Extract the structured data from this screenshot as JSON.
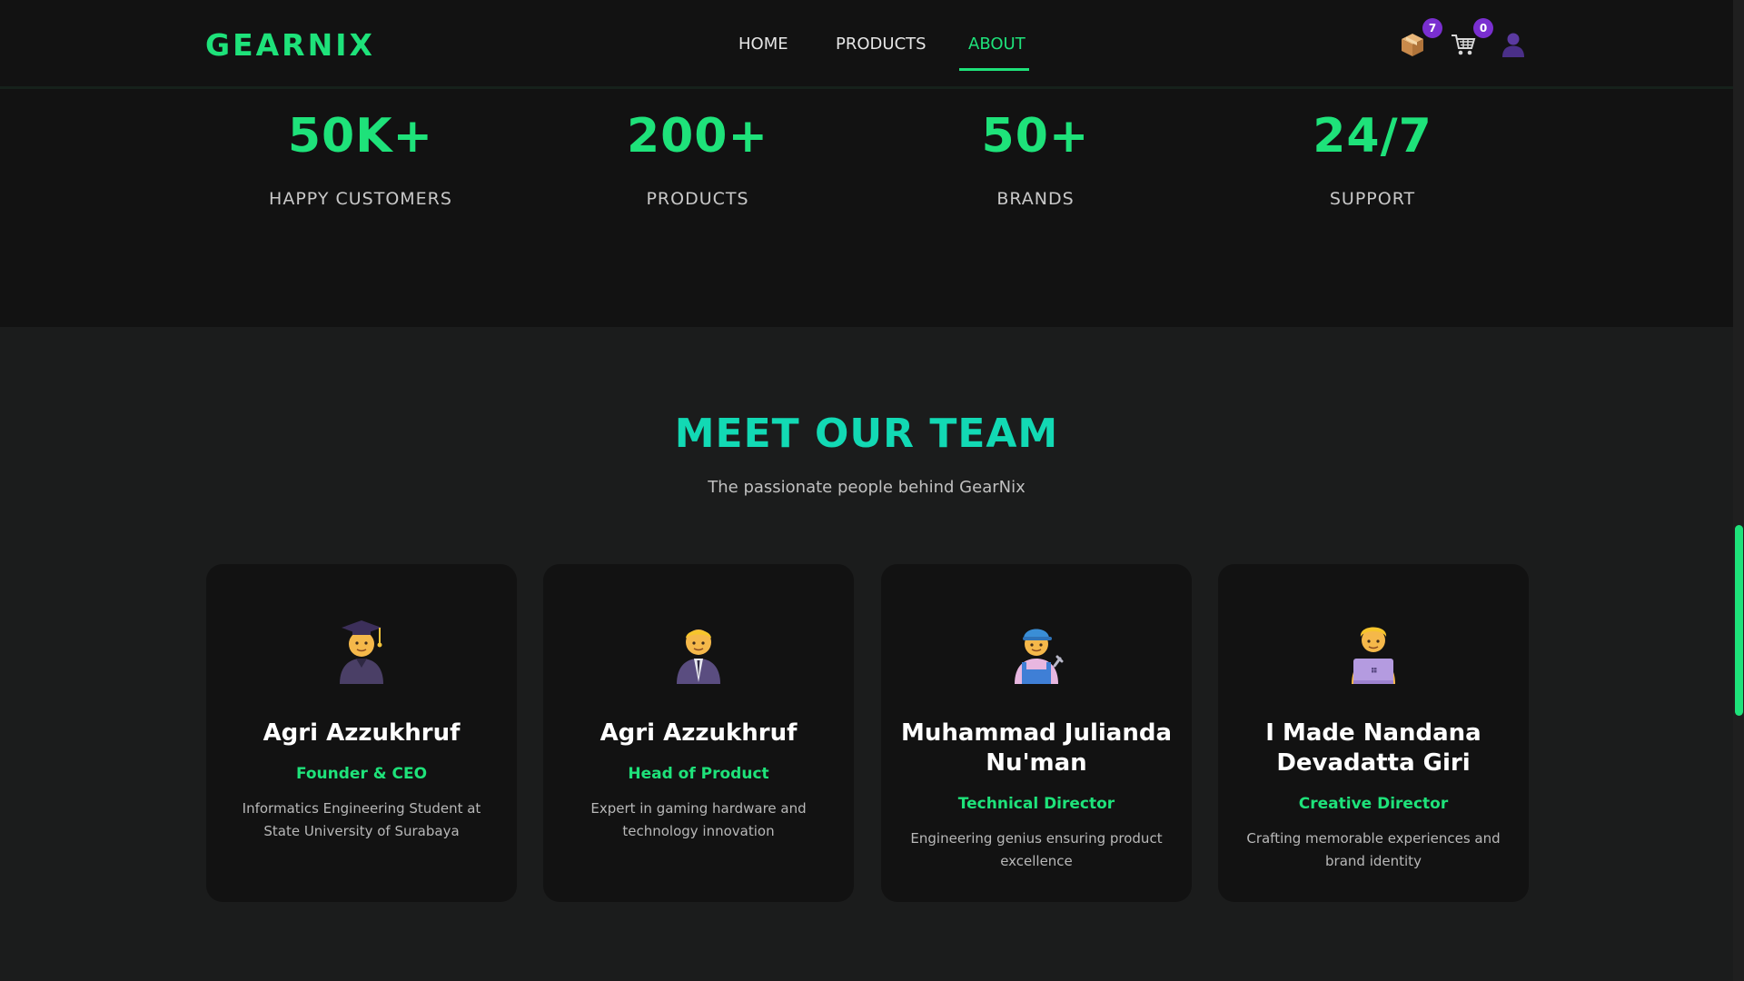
{
  "brand": {
    "logo": "GEARNIX"
  },
  "nav": {
    "items": [
      {
        "label": "HOME",
        "active": false
      },
      {
        "label": "PRODUCTS",
        "active": false
      },
      {
        "label": "ABOUT",
        "active": true
      }
    ]
  },
  "header_icons": {
    "box": {
      "icon": "package-icon",
      "badge": "7"
    },
    "cart": {
      "icon": "cart-icon",
      "badge": "0"
    },
    "user": {
      "icon": "user-icon"
    }
  },
  "stats": [
    {
      "value": "50K+",
      "label": "HAPPY CUSTOMERS"
    },
    {
      "value": "200+",
      "label": "PRODUCTS"
    },
    {
      "value": "50+",
      "label": "BRANDS"
    },
    {
      "value": "24/7",
      "label": "SUPPORT"
    }
  ],
  "team": {
    "title": "MEET OUR TEAM",
    "subtitle": "The passionate people behind GearNix",
    "members": [
      {
        "avatar": "graduate-icon",
        "name": "Agri Azzukhruf",
        "role": "Founder & CEO",
        "description": "Informatics Engineering Student at State University of Surabaya"
      },
      {
        "avatar": "businessman-icon",
        "name": "Agri Azzukhruf",
        "role": "Head of Product",
        "description": "Expert in gaming hardware and technology innovation"
      },
      {
        "avatar": "mechanic-icon",
        "name": "Muhammad Julianda Nu'man",
        "role": "Technical Director",
        "description": "Engineering genius ensuring product excellence"
      },
      {
        "avatar": "technologist-icon",
        "name": "I Made Nandana Devadatta Giri",
        "role": "Creative Director",
        "description": "Crafting memorable experiences and brand identity"
      }
    ]
  },
  "colors": {
    "accent": "#1ee27a",
    "title": "#12d9b4",
    "badge": "#7a2fd0",
    "background": "#1b1c1c",
    "panel": "#121212"
  }
}
